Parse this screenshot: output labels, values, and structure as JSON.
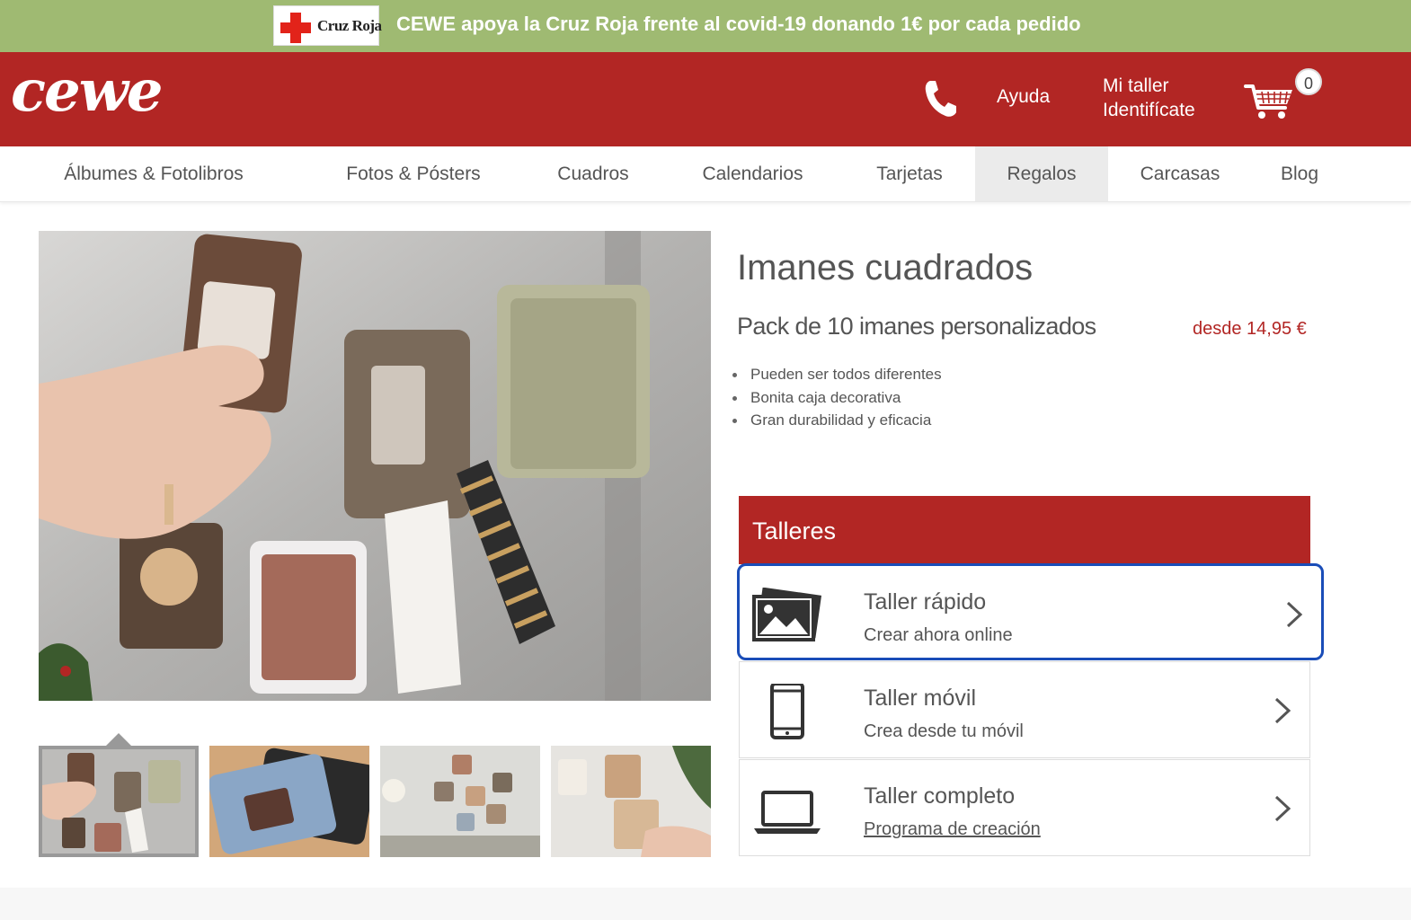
{
  "promo": {
    "logo_text": "Cruz Roja",
    "text": "CEWE apoya la Cruz Roja frente al covid-19 donando 1€ por cada pedido",
    "background": "#9fba72"
  },
  "header": {
    "logo_text": "cewe",
    "help_label": "Ayuda",
    "account_line1": "Mi taller",
    "account_line2": "Identifícate",
    "cart_count": "0",
    "brand_color": "#b22624"
  },
  "nav": {
    "items": [
      {
        "label": "Álbumes & Fotolibros"
      },
      {
        "label": "Fotos & Pósters"
      },
      {
        "label": "Cuadros"
      },
      {
        "label": "Calendarios"
      },
      {
        "label": "Tarjetas"
      },
      {
        "label": "Regalos",
        "active": true
      },
      {
        "label": "Carcasas"
      },
      {
        "label": "Blog"
      }
    ]
  },
  "product": {
    "title": "Imanes cuadrados",
    "subtitle": "Pack de 10 imanes personalizados",
    "price": "desde 14,95 €",
    "features": [
      "Pueden ser todos diferentes",
      "Bonita caja decorativa",
      "Gran durabilidad y eficacia"
    ],
    "thumbnails": 4,
    "selected_thumbnail": 1
  },
  "talleres": {
    "heading": "Talleres",
    "options": [
      {
        "title": "Taller rápido",
        "subtitle": "Crear ahora online",
        "icon": "photos-icon",
        "focused": true
      },
      {
        "title": "Taller móvil",
        "subtitle": "Crea desde tu móvil",
        "icon": "smartphone-icon"
      },
      {
        "title": "Taller completo",
        "subtitle": "Programa de creación",
        "icon": "laptop-icon",
        "subtitle_is_link": true
      }
    ]
  }
}
